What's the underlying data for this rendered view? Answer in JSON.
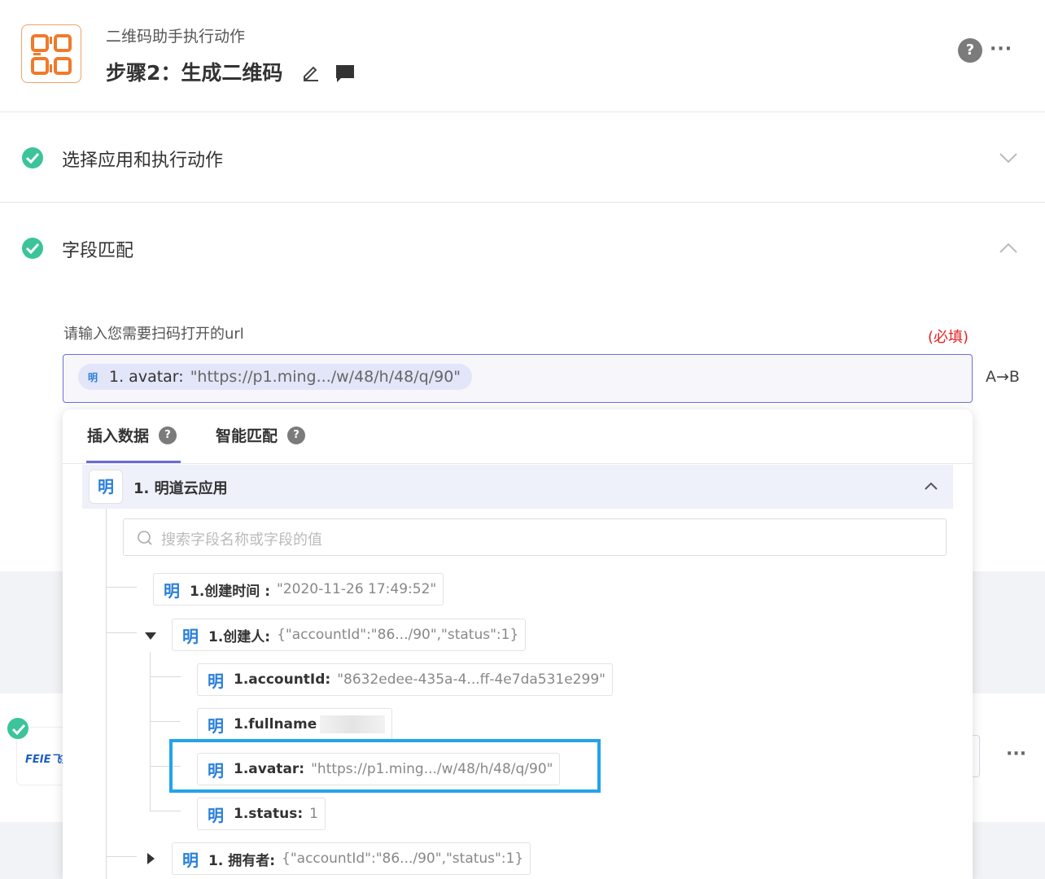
{
  "header": {
    "breadcrumb": "二维码助手执行动作",
    "step_title": "步骤2：生成二维码"
  },
  "sections": [
    {
      "title": "选择应用和执行动作",
      "state": "collapsed"
    },
    {
      "title": "字段匹配",
      "state": "expanded"
    }
  ],
  "field": {
    "label": "请输入您需要扫码打开的url",
    "required": "(必填)",
    "token": {
      "icon": "明",
      "key": "1. avatar:",
      "value": "\"https://p1.ming.../w/48/h/48/q/90\""
    },
    "ab_label": "A→B"
  },
  "panel": {
    "tabs": [
      {
        "label": "插入数据",
        "active": true
      },
      {
        "label": "智能匹配",
        "active": false
      }
    ],
    "group": {
      "icon": "明",
      "label": "1. 明道云应用"
    },
    "search_placeholder": "搜索字段名称或字段的值",
    "nodes": [
      {
        "icon": "明",
        "key": "1.创建时间 :",
        "value": "\"2020-11-26 17:49:52\""
      },
      {
        "icon": "明",
        "key": "1.创建人:",
        "value": "{\"accountId\":\"86.../90\",\"status\":1}"
      },
      {
        "icon": "明",
        "key": "1.accountId:",
        "value": "\"8632edee-435a-4...ff-4e7da531e299\""
      },
      {
        "icon": "明",
        "key": "1.fullname",
        "value": ""
      },
      {
        "icon": "明",
        "key": "1.avatar:",
        "value": "\"https://p1.ming.../w/48/h/48/q/90\""
      },
      {
        "icon": "明",
        "key": "1.status:",
        "value": "1"
      },
      {
        "icon": "明",
        "key": "1. 拥有者:",
        "value": "{\"accountId\":\"86.../90\",\"status\":1}"
      }
    ]
  },
  "background": {
    "logo_text": "FEIE飞鹅"
  },
  "colors": {
    "accent": "#6b6bd6",
    "success": "#3bc49a",
    "required": "#e62323",
    "highlight": "#23a3ea",
    "token_icon": "#2a7fd9"
  }
}
